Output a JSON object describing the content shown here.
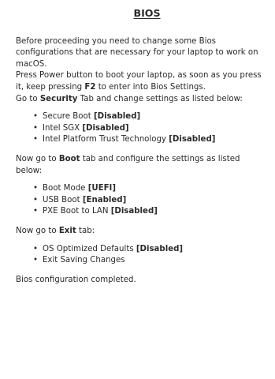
{
  "title": "BIOS",
  "intro": [
    "Before proceeding you need to change some Bios configurations that are necessary for your laptop to work on macOS.",
    "Press Power button to boot your laptop, as soon as you press it, keep pressing ",
    "F2",
    " to enter into Bios Settings."
  ],
  "security": {
    "prefix": "Go to ",
    "tab": "Security",
    "suffix": " Tab and change settings as listed below:",
    "items": [
      {
        "name": "Secure Boot ",
        "value": "[Disabled]"
      },
      {
        "name": "Intel SGX ",
        "value": "[Disabled]"
      },
      {
        "name": "Intel Platform Trust Technology ",
        "value": "[Disabled]"
      }
    ]
  },
  "boot": {
    "prefix": "Now go to ",
    "tab": "Boot",
    "suffix": " tab and configure the settings as listed below:",
    "items": [
      {
        "name": "Boot Mode ",
        "value": "[UEFI]"
      },
      {
        "name": "USB Boot ",
        "value": "[Enabled]"
      },
      {
        "name": "PXE Boot to LAN ",
        "value": "[Disabled]"
      }
    ]
  },
  "exit": {
    "prefix": "Now go to ",
    "tab": "Exit",
    "suffix": " tab:",
    "items": [
      {
        "name": "OS Optimized Defaults ",
        "value": "[Disabled]"
      },
      {
        "name": "Exit Saving Changes",
        "value": ""
      }
    ]
  },
  "footer": "Bios configuration completed."
}
